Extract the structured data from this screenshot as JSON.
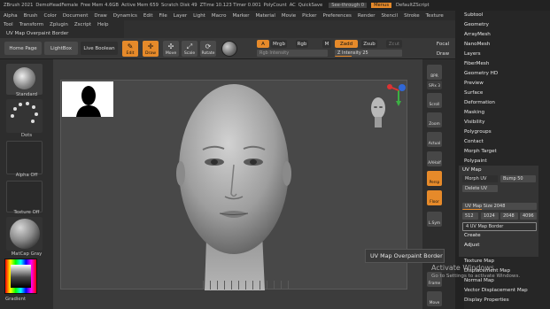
{
  "titlebar": {
    "items": [
      "ZBrush 2021",
      "DemoHeadFemale",
      "Free Mem 4.6GB",
      "Active Mem 659",
      "Scratch Disk 49",
      "ZTime 10.123 Timer 0.001",
      "PolyCount",
      "AC",
      "QuickSave"
    ],
    "seethrough": "See-through 0",
    "menus": "Menus",
    "script": "DefaultZScript"
  },
  "menubar": [
    "Alpha",
    "Brush",
    "Color",
    "Document",
    "Draw",
    "Dynamics",
    "Edit",
    "File",
    "Layer",
    "Light",
    "Macro",
    "Marker",
    "Material",
    "Movie",
    "Picker",
    "Preferences",
    "Render",
    "Stencil",
    "Stroke",
    "Texture"
  ],
  "submenu": [
    "Tool",
    "Transform",
    "Zplugin",
    "Zscript",
    "Help"
  ],
  "subtitle": "UV Map Overpaint Border",
  "toolbar": {
    "home": "Home Page",
    "lightbox": "LightBox",
    "liveboolean": "Live Boolean",
    "edit": "Edit",
    "draw": "Draw",
    "move": "Move",
    "scale": "Scale",
    "rotate": "Rotate",
    "a_btn": "A",
    "mrgb": "Mrgb",
    "rgb": "Rgb",
    "m": "M",
    "zadd": "Zadd",
    "zsub": "Zsub",
    "zcut": "Zcut",
    "rgb_intensity": "Rgb Intensity",
    "z_intensity": "Z Intensity 25",
    "focal": "Focal",
    "draw_size": "Draw"
  },
  "left": {
    "standard": "Standard",
    "dots": "Dots",
    "alpha": "Alpha Off",
    "texture": "Texture Off",
    "matcap": "MatCap Gray",
    "gradient": "Gradient"
  },
  "rightbar": [
    "BPR",
    "SPix 3",
    "Scroll",
    "Zoom",
    "Actual",
    "AAHalf",
    "Persp",
    "Floor",
    "L.Sym",
    "Frame",
    "Move"
  ],
  "panel": {
    "items_top": [
      "Subtool",
      "Geometry",
      "ArrayMesh",
      "NanoMesh",
      "Layers",
      "FiberMesh",
      "Geometry HD",
      "Preview",
      "Surface",
      "Deformation",
      "Masking",
      "Visibility",
      "Polygroups",
      "Contact",
      "Morph Target",
      "Polypaint"
    ],
    "uvmap_title": "UV Map",
    "morph_uv": "Morph UV",
    "bump": "Bump 50",
    "delete_uv": "Delete UV",
    "uvmap_size": "UV Map Size 2048",
    "sizes": [
      "512",
      "1024",
      "2048",
      "4096"
    ],
    "border": "4 UV Map Border",
    "create": "Create",
    "adjust": "Adjust",
    "items_bottom": [
      "Texture Map",
      "Displacement Map",
      "Normal Map",
      "Vector Displacement Map",
      "Display Properties"
    ]
  },
  "tooltip": "UV Map Overpaint Border",
  "watermark": {
    "title": "Activate Windows",
    "body": "Go to Settings to activate Windows."
  }
}
